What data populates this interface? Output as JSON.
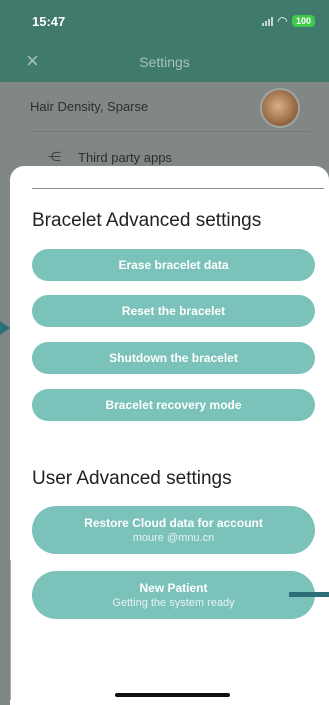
{
  "status_bar": {
    "time": "15:47",
    "battery": "100",
    "icons": [
      "signal-icon",
      "wifi-icon",
      "battery-icon"
    ]
  },
  "nav": {
    "close_icon": "×",
    "title": "Settings"
  },
  "background_list": [
    {
      "label": "Hair Density, Sparse",
      "icon": "avatar"
    },
    {
      "label": "Third party apps",
      "icon": "share-icon"
    }
  ],
  "sheet": {
    "bracelet_title": "Bracelet Advanced settings",
    "bracelet_buttons": [
      {
        "label": "Erase bracelet data"
      },
      {
        "label": "Reset the bracelet"
      },
      {
        "label": "Shutdown the bracelet"
      },
      {
        "label": "Bracelet recovery mode"
      }
    ],
    "user_title": "User Advanced settings",
    "user_buttons": [
      {
        "label": "Restore Cloud data for account",
        "sub": "moure @mnu.cn"
      },
      {
        "label": "New Patient",
        "sub": "Getting the system ready"
      }
    ]
  },
  "colors": {
    "button": "#7bc2ba",
    "header": "#3f7a6d",
    "annotation": "#2c6f79"
  }
}
